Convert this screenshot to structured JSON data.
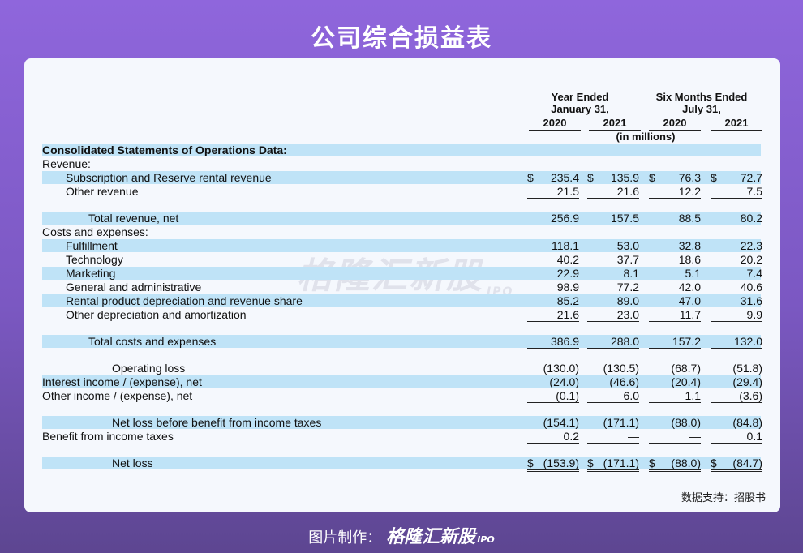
{
  "page_title": "公司综合损益表",
  "watermark": {
    "name": "格隆汇新股",
    "sub": "IPO"
  },
  "headers": {
    "group1": [
      "Year Ended",
      "January 31,"
    ],
    "group2": [
      "Six Months Ended",
      "July 31,"
    ],
    "years": [
      "2020",
      "2021",
      "2020",
      "2021"
    ],
    "unit": "(in millions)"
  },
  "rows": [
    {
      "label": "Consolidated Statements of Operations Data:",
      "indent": 0,
      "bold": true,
      "hl": true,
      "values": []
    },
    {
      "label": "Revenue:",
      "indent": 0,
      "hl": false,
      "values": []
    },
    {
      "label": "Subscription and Reserve rental revenue",
      "indent": 1,
      "hl": true,
      "dollar": true,
      "values": [
        "235.4",
        "135.9",
        "76.3",
        "72.7"
      ]
    },
    {
      "label": "Other revenue",
      "indent": 1,
      "hl": false,
      "ul": "single",
      "values": [
        "21.5",
        "21.6",
        "12.2",
        "7.5"
      ]
    },
    {
      "label": "Total revenue, net",
      "indent": 2,
      "hl": true,
      "gap": true,
      "values": [
        "256.9",
        "157.5",
        "88.5",
        "80.2"
      ]
    },
    {
      "label": "Costs and expenses:",
      "indent": 0,
      "hl": false,
      "values": []
    },
    {
      "label": "Fulfillment",
      "indent": 1,
      "hl": true,
      "values": [
        "118.1",
        "53.0",
        "32.8",
        "22.3"
      ]
    },
    {
      "label": "Technology",
      "indent": 1,
      "hl": false,
      "values": [
        "40.2",
        "37.7",
        "18.6",
        "20.2"
      ]
    },
    {
      "label": "Marketing",
      "indent": 1,
      "hl": true,
      "values": [
        "22.9",
        "8.1",
        "5.1",
        "7.4"
      ]
    },
    {
      "label": "General and administrative",
      "indent": 1,
      "hl": false,
      "values": [
        "98.9",
        "77.2",
        "42.0",
        "40.6"
      ]
    },
    {
      "label": "Rental product depreciation and revenue share",
      "indent": 1,
      "hl": true,
      "values": [
        "85.2",
        "89.0",
        "47.0",
        "31.6"
      ]
    },
    {
      "label": "Other depreciation and amortization",
      "indent": 1,
      "hl": false,
      "ul": "single",
      "values": [
        "21.6",
        "23.0",
        "11.7",
        "9.9"
      ]
    },
    {
      "label": "Total costs and expenses",
      "indent": 2,
      "hl": true,
      "gap": true,
      "ul": "single",
      "values": [
        "386.9",
        "288.0",
        "157.2",
        "132.0"
      ]
    },
    {
      "label": "Operating loss",
      "indent": 3,
      "hl": false,
      "gap": true,
      "values": [
        "(130.0)",
        "(130.5)",
        "(68.7)",
        "(51.8)"
      ]
    },
    {
      "label": "Interest income / (expense), net",
      "indent": 0,
      "hl": true,
      "values": [
        "(24.0)",
        "(46.6)",
        "(20.4)",
        "(29.4)"
      ]
    },
    {
      "label": "Other income / (expense), net",
      "indent": 0,
      "hl": false,
      "ul": "single",
      "values": [
        "(0.1)",
        "6.0",
        "1.1",
        "(3.6)"
      ]
    },
    {
      "label": "Net loss before benefit from income taxes",
      "indent": 3,
      "hl": true,
      "gap": true,
      "values": [
        "(154.1)",
        "(171.1)",
        "(88.0)",
        "(84.8)"
      ]
    },
    {
      "label": "Benefit from income taxes",
      "indent": 0,
      "hl": false,
      "ul": "single",
      "values": [
        "0.2",
        "—",
        "—",
        "0.1"
      ]
    },
    {
      "label": "Net loss",
      "indent": 3,
      "hl": true,
      "gap": true,
      "dollar": true,
      "ul": "double",
      "values": [
        "(153.9)",
        "(171.1)",
        "(88.0)",
        "(84.7)"
      ]
    }
  ],
  "source_note": "数据支持：招股书",
  "footer": {
    "prefix": "图片制作：",
    "brand": "格隆汇新股",
    "brand_sub": "IPO"
  }
}
